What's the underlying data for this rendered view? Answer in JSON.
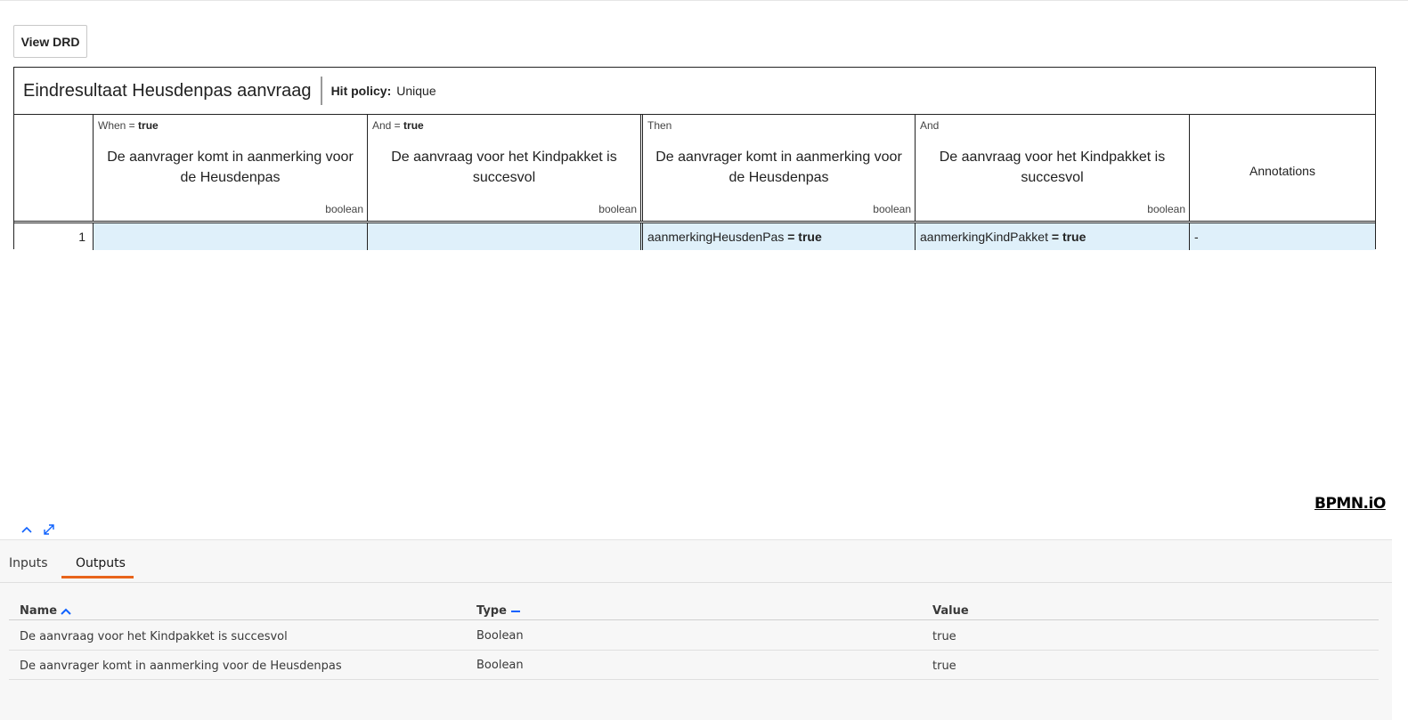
{
  "toolbar": {
    "view_drd_label": "View DRD"
  },
  "decision": {
    "name": "Eindresultaat Heusdenpas aanvraag",
    "hit_policy_label": "Hit policy:",
    "hit_policy_value": "Unique"
  },
  "columns": [
    {
      "label_prefix": "When = ",
      "label_bold": "true",
      "title": "De aanvrager komt in aanmerking voor de Heusdenpas",
      "type": "boolean"
    },
    {
      "label_prefix": "And = ",
      "label_bold": "true",
      "title": "De aanvraag voor het Kindpakket is succesvol",
      "type": "boolean"
    },
    {
      "label_prefix": "Then",
      "label_bold": "",
      "title": "De aanvrager komt in aanmerking voor de Heusdenpas",
      "type": "boolean"
    },
    {
      "label_prefix": "And",
      "label_bold": "",
      "title": "De aanvraag voor het Kindpakket is succesvol",
      "type": "boolean"
    },
    {
      "title": "Annotations"
    }
  ],
  "rules": [
    {
      "index": "1",
      "input1": "",
      "input2": "",
      "output1_name": "aanmerkingHeusdenPas",
      "output1_expr": " = true",
      "output2_name": "aanmerkingKindPakket",
      "output2_expr": " = true",
      "annotation": "-"
    }
  ],
  "branding": {
    "logo_text": "BPMN.iO"
  },
  "panel_icons": [
    "chevron-up-icon",
    "expand-icon"
  ],
  "results_panel": {
    "tabs": [
      {
        "label": "Inputs",
        "active": false
      },
      {
        "label": "Outputs",
        "active": true
      }
    ],
    "headers": {
      "name": "Name",
      "type": "Type",
      "value": "Value"
    },
    "rows": [
      {
        "name": "De aanvraag voor het Kindpakket is succesvol",
        "type": "Boolean",
        "value": "true"
      },
      {
        "name": "De aanvrager komt in aanmerking voor de Heusdenpas",
        "type": "Boolean",
        "value": "true"
      }
    ]
  },
  "colors": {
    "accent": "#0f62fe",
    "tab_underline": "#e8641b",
    "rule_cell": "#dff0fa"
  }
}
